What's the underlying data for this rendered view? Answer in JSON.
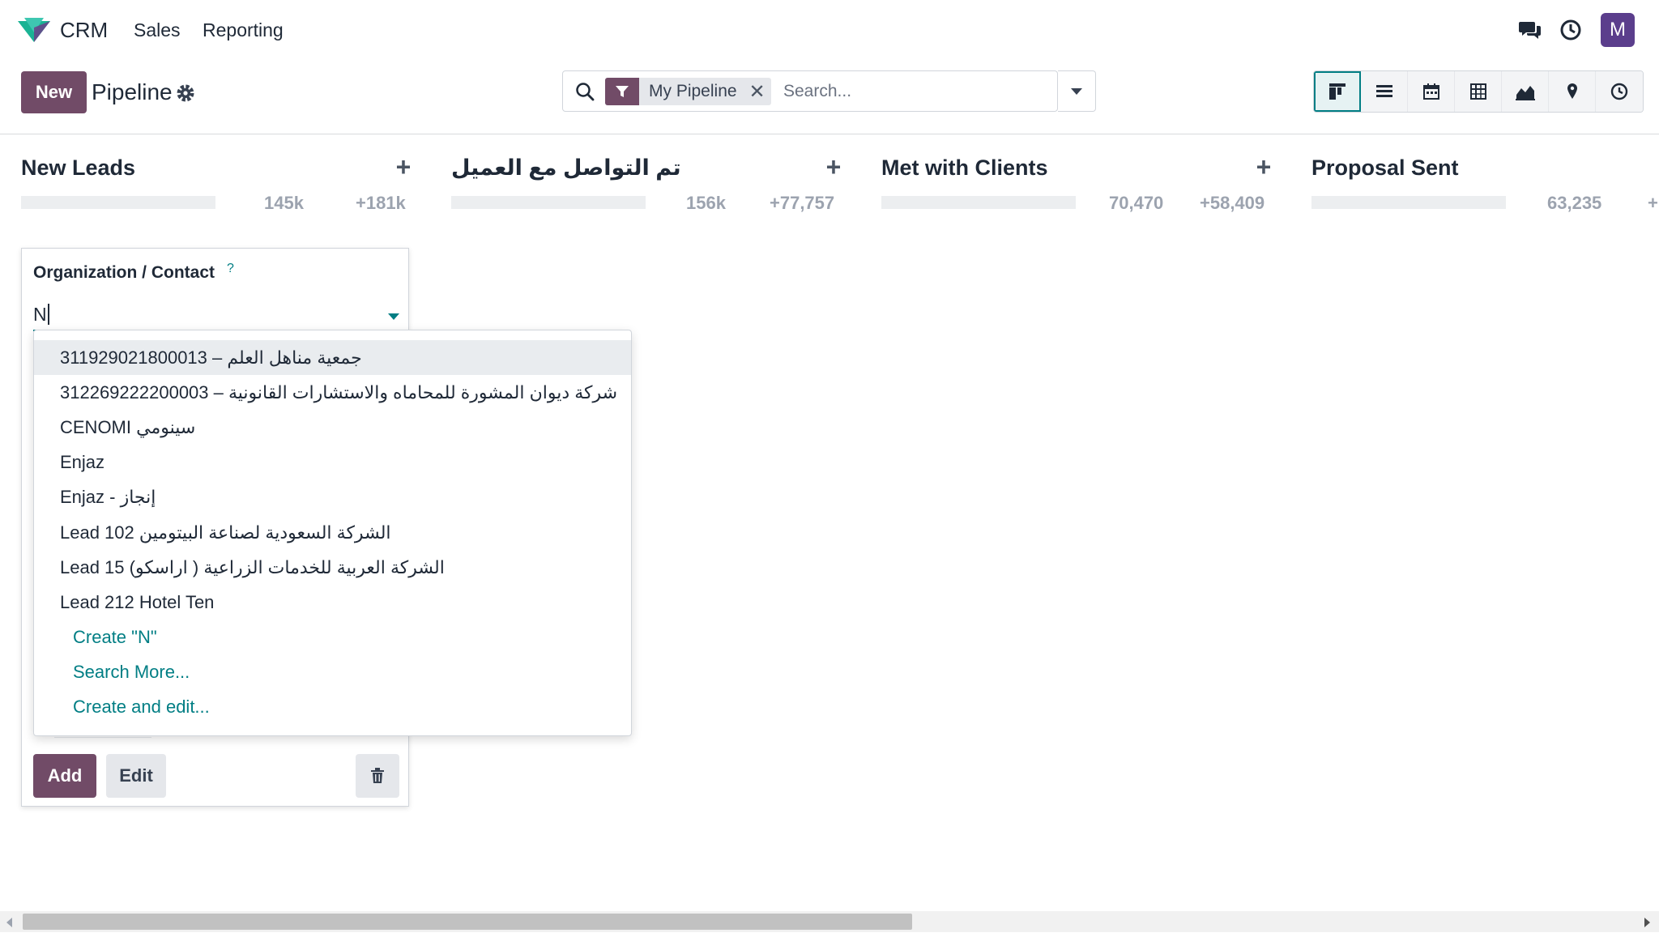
{
  "navbar": {
    "app_name": "CRM",
    "menu": [
      "Sales",
      "Reporting"
    ],
    "avatar_letter": "M"
  },
  "control_panel": {
    "new_label": "New",
    "breadcrumb": "Pipeline",
    "search": {
      "facet_label": "My Pipeline",
      "placeholder": "Search..."
    },
    "views": [
      "kanban",
      "list",
      "calendar",
      "pivot",
      "graph",
      "map",
      "activity"
    ],
    "active_view": "kanban"
  },
  "columns": [
    {
      "title": "New Leads",
      "expected": "145k",
      "recurring": "+181k"
    },
    {
      "title": "تم التواصل مع العميل",
      "expected": "156k",
      "recurring": "+77,757"
    },
    {
      "title": "Met with Clients",
      "expected": "70,470",
      "recurring": "+58,409"
    },
    {
      "title": "Proposal Sent",
      "expected": "63,235",
      "recurring": "+"
    }
  ],
  "quick_create": {
    "field_label": "Organization / Contact",
    "help_mark": "?",
    "input_value": "N",
    "add_label": "Add",
    "edit_label": "Edit"
  },
  "dropdown": {
    "items": [
      "311929021800013 – جمعية مناهل العلم",
      "312269222200003 – شركة ديوان المشورة للمحاماه والاستشارات القانونية",
      "CENOMI سينومي",
      "Enjaz",
      "Enjaz - إنجاز",
      "Lead 102 الشركة السعودية لصناعة البيتومين",
      "Lead 15 الشركة العربية للخدمات الزراعية ( اراسكو)",
      "Lead 212 Hotel Ten"
    ],
    "actions": [
      "Create \"N\"",
      "Search More...",
      "Create and edit..."
    ]
  },
  "colors": {
    "primary": "#714b67",
    "accent": "#017e84",
    "avatar": "#5b3e8c"
  }
}
